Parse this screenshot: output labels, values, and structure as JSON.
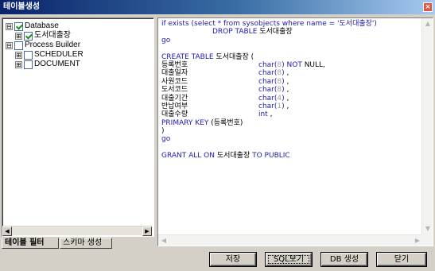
{
  "window": {
    "title": "테이블생성",
    "close_glyph": "×"
  },
  "tree": {
    "items": [
      {
        "expander": "⊟",
        "checked": true,
        "label": "Database"
      },
      {
        "expander": "⊞",
        "checked": true,
        "label": "도서대출장"
      },
      {
        "expander": "⊟",
        "checked": false,
        "label": "Process Builder"
      },
      {
        "expander": "⊞",
        "checked": false,
        "label": "SCHEDULER"
      },
      {
        "expander": "⊞",
        "checked": false,
        "label": "DOCUMENT"
      }
    ]
  },
  "tabs": [
    {
      "label": "테이블 필터",
      "active": true
    },
    {
      "label": "스키마 생성",
      "active": false
    }
  ],
  "sql": {
    "line1_kw1": "if exists (select * from sysobjects where name = '도서대출장')",
    "line2_kw": "DROP TABLE",
    "line2_name": " 도서대출장",
    "go1": "go",
    "create_kw": "CREATE TABLE",
    "create_name": " 도서대출장 (",
    "columns": [
      {
        "name": "등록번호",
        "type": "char",
        "open": "(",
        "size": "8",
        "close": ")",
        "suffix_kw": " NOT",
        "suffix": " NULL,"
      },
      {
        "name": "대출일자",
        "type": "char",
        "open": "(",
        "size": "8",
        "close": ")",
        "suffix_kw": "",
        "suffix": " ,"
      },
      {
        "name": "사원코드",
        "type": "char",
        "open": "(",
        "size": "8",
        "close": ")",
        "suffix_kw": "",
        "suffix": " ,"
      },
      {
        "name": "도서코드",
        "type": "char",
        "open": "(",
        "size": "8",
        "close": ")",
        "suffix_kw": "",
        "suffix": " ,"
      },
      {
        "name": "대출기간",
        "type": "char",
        "open": "(",
        "size": "4",
        "close": ")",
        "suffix_kw": "",
        "suffix": " ,"
      },
      {
        "name": "반납여부",
        "type": "char",
        "open": "(",
        "size": "1",
        "close": ")",
        "suffix_kw": "",
        "suffix": " ,"
      },
      {
        "name": "대출수량",
        "type": "int",
        "open": "",
        "size": "",
        "close": "",
        "suffix_kw": "",
        "suffix": " ,"
      }
    ],
    "pk_kw": "PRIMARY KEY",
    "pk_rest": " (등록번호)",
    "close_paren": ")",
    "go2": "go",
    "grant_kw1": "GRANT ALL ON",
    "grant_name": " 도서대출장 ",
    "grant_kw2": "TO PUBLIC"
  },
  "buttons": {
    "save": "저장",
    "sql_view": "SQL보기",
    "db_create": "DB 생성",
    "close": "닫기"
  },
  "scroll": {
    "left": "◀",
    "right": "▶",
    "up": "▲",
    "down": "▼"
  }
}
